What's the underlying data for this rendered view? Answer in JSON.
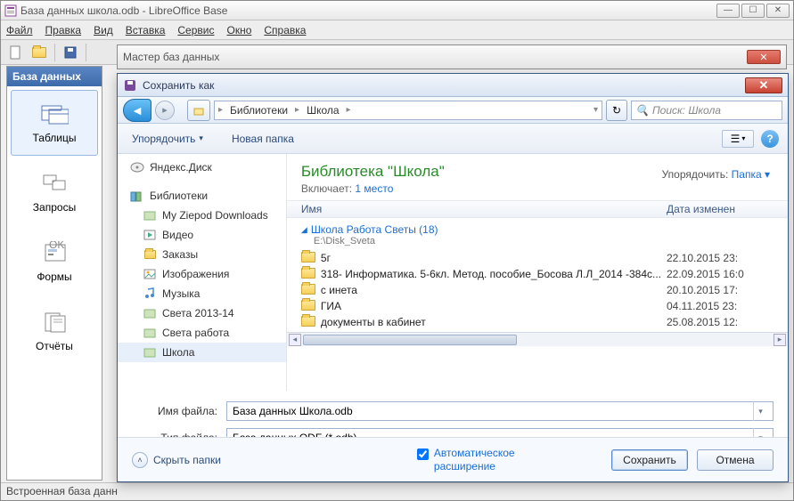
{
  "main": {
    "title": "База данных школа.odb - LibreOffice Base",
    "menus": [
      "Файл",
      "Правка",
      "Вид",
      "Вставка",
      "Сервис",
      "Окно",
      "Справка"
    ],
    "side_header": "База данных",
    "side_items": [
      "Таблицы",
      "Запросы",
      "Формы",
      "Отчёты"
    ],
    "status": "Встроенная база данн"
  },
  "wizard": {
    "title": "Мастер баз данных"
  },
  "dialog": {
    "title": "Сохранить как",
    "breadcrumb": [
      "Библиотеки",
      "Школа"
    ],
    "search_placeholder": "Поиск: Школа",
    "organize": "Упорядочить",
    "new_folder": "Новая папка",
    "tree": {
      "root": "Яндекс.Диск",
      "cat": "Библиотеки",
      "items": [
        "My Ziepod Downloads",
        "Видео",
        "Заказы",
        "Изображения",
        "Музыка",
        "Света 2013-14",
        "Света работа",
        "Школа"
      ]
    },
    "lib": {
      "title": "Библиотека \"Школа\"",
      "includes_label": "Включает:",
      "includes_link": "1 место",
      "sort_label": "Упорядочить:",
      "sort_link": "Папка"
    },
    "cols": {
      "name": "Имя",
      "date": "Дата изменен"
    },
    "group": {
      "name": "Школа Работа Светы (18)",
      "path": "E:\\Disk_Sveta"
    },
    "files": [
      {
        "name": "5г",
        "date": "22.10.2015 23:"
      },
      {
        "name": "318- Информатика. 5-6кл. Метод. пособие_Босова Л.Л_2014 -384с...",
        "date": "22.09.2015 16:0"
      },
      {
        "name": "с инета",
        "date": "20.10.2015 17:"
      },
      {
        "name": "ГИА",
        "date": "04.11.2015 23:"
      },
      {
        "name": "документы в кабинет",
        "date": "25.08.2015 12:"
      }
    ],
    "form": {
      "name_label": "Имя файла:",
      "name_value": "База данных Школа.odb",
      "type_label": "Тип файла:",
      "type_value": "База данных ODF (*.odb)"
    },
    "hide_folders": "Скрыть папки",
    "auto_ext": "Автоматическое расширение",
    "save": "Сохранить",
    "cancel": "Отмена"
  }
}
